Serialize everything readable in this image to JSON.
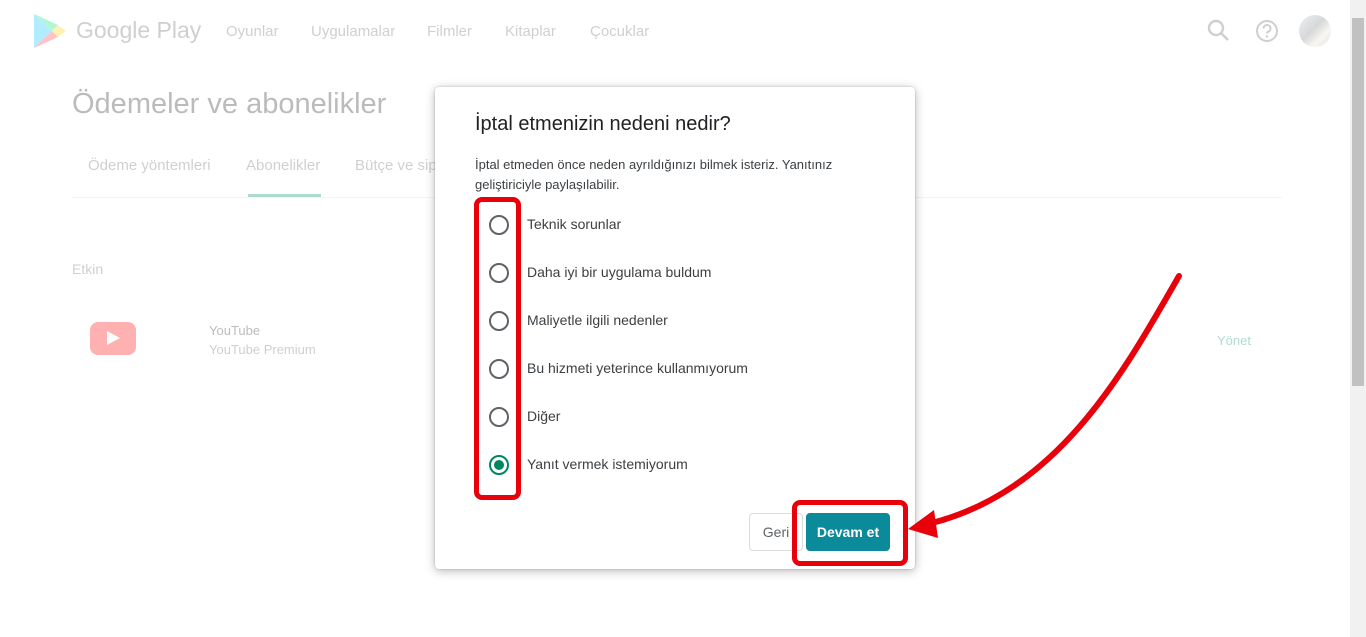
{
  "header": {
    "brand": "Google Play",
    "nav": [
      "Oyunlar",
      "Uygulamalar",
      "Filmler",
      "Kitaplar",
      "Çocuklar"
    ],
    "icons": [
      "search-icon",
      "help-icon",
      "avatar"
    ]
  },
  "page": {
    "title": "Ödemeler ve abonelikler",
    "tabs": [
      "Ödeme yöntemleri",
      "Abonelikler",
      "Bütçe ve sip"
    ],
    "active_tab": "Abonelikler",
    "section_label": "Etkin",
    "subscription": {
      "app": "YouTube",
      "plan": "YouTube Premium",
      "action": "Yönet"
    }
  },
  "dialog": {
    "title": "İptal etmenizin nedeni nedir?",
    "description": "İptal etmeden önce neden ayrıldığınızı bilmek isteriz. Yanıtınız geliştiriciyle paylaşılabilir.",
    "options": [
      {
        "label": "Teknik sorunlar",
        "selected": false
      },
      {
        "label": "Daha iyi bir uygulama buldum",
        "selected": false
      },
      {
        "label": "Maliyetle ilgili nedenler",
        "selected": false
      },
      {
        "label": "Bu hizmeti yeterince kullanmıyorum",
        "selected": false
      },
      {
        "label": "Diğer",
        "selected": false
      },
      {
        "label": "Yanıt vermek istemiyorum",
        "selected": true
      }
    ],
    "back_label": "Geri",
    "continue_label": "Devam et"
  },
  "colors": {
    "accent": "#01875f",
    "continue_button": "#0b8a9a",
    "annotation": "#e8000b"
  }
}
